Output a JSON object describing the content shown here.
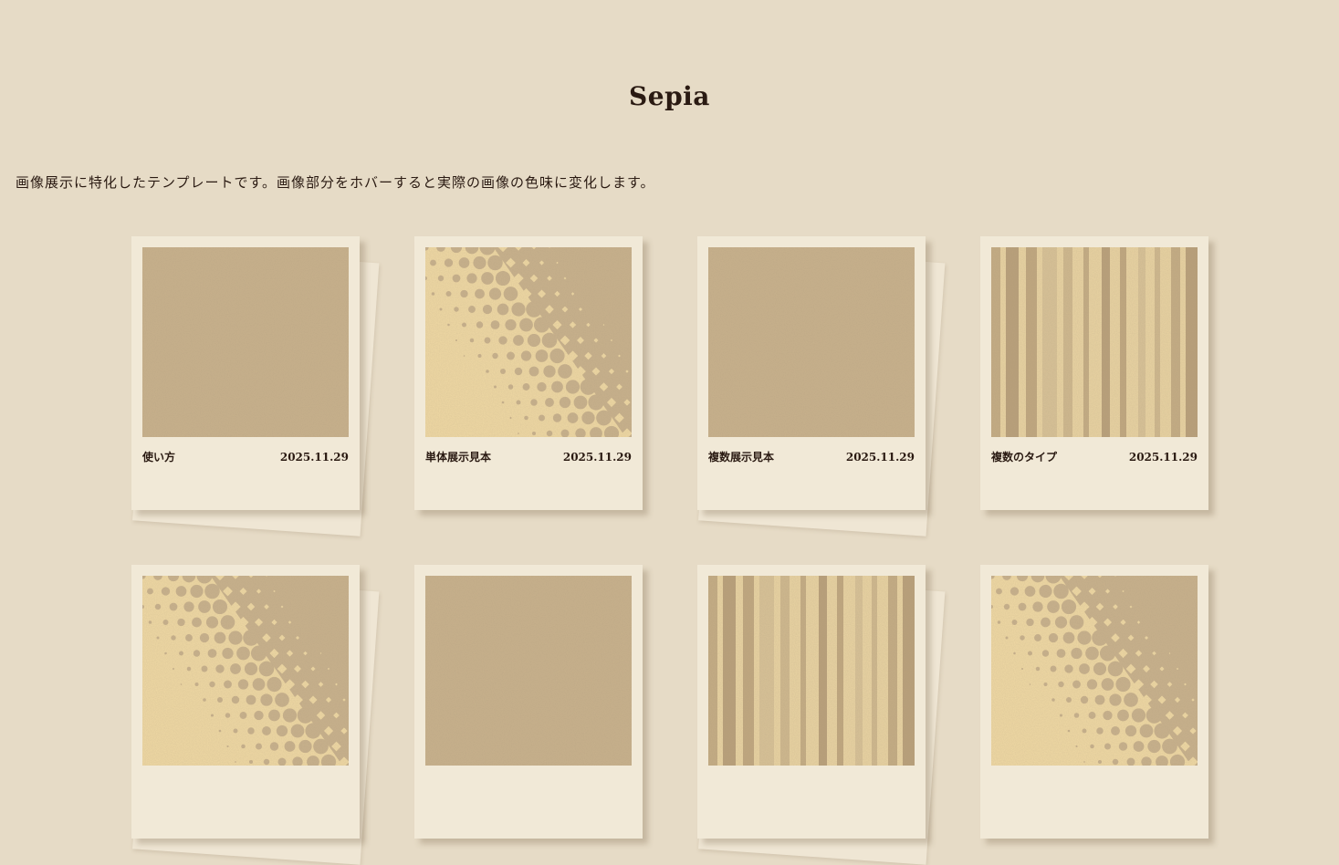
{
  "site": {
    "title": "Sepia",
    "intro": "画像展示に特化したテンプレートです。画像部分をホバーすると実際の画像の色味に変化します。"
  },
  "colors": {
    "background": "#e6dbc6",
    "card": "#f1e9d7",
    "text": "#2a1a12",
    "image_base": "#c8b18c",
    "image_light": "#f0d9a4"
  },
  "posts": [
    {
      "title": "使い方",
      "date": "2025.11.29",
      "pattern": "plain",
      "stacked": true
    },
    {
      "title": "単体展示見本",
      "date": "2025.11.29",
      "pattern": "halftone",
      "stacked": false
    },
    {
      "title": "複数展示見本",
      "date": "2025.11.29",
      "pattern": "plain",
      "stacked": true
    },
    {
      "title": "複数のタイプ",
      "date": "2025.11.29",
      "pattern": "stripes",
      "stacked": false
    },
    {
      "title": "",
      "date": "",
      "pattern": "halftone",
      "stacked": true
    },
    {
      "title": "",
      "date": "",
      "pattern": "plain",
      "stacked": false
    },
    {
      "title": "",
      "date": "",
      "pattern": "stripes",
      "stacked": true
    },
    {
      "title": "",
      "date": "",
      "pattern": "halftone",
      "stacked": false
    }
  ]
}
